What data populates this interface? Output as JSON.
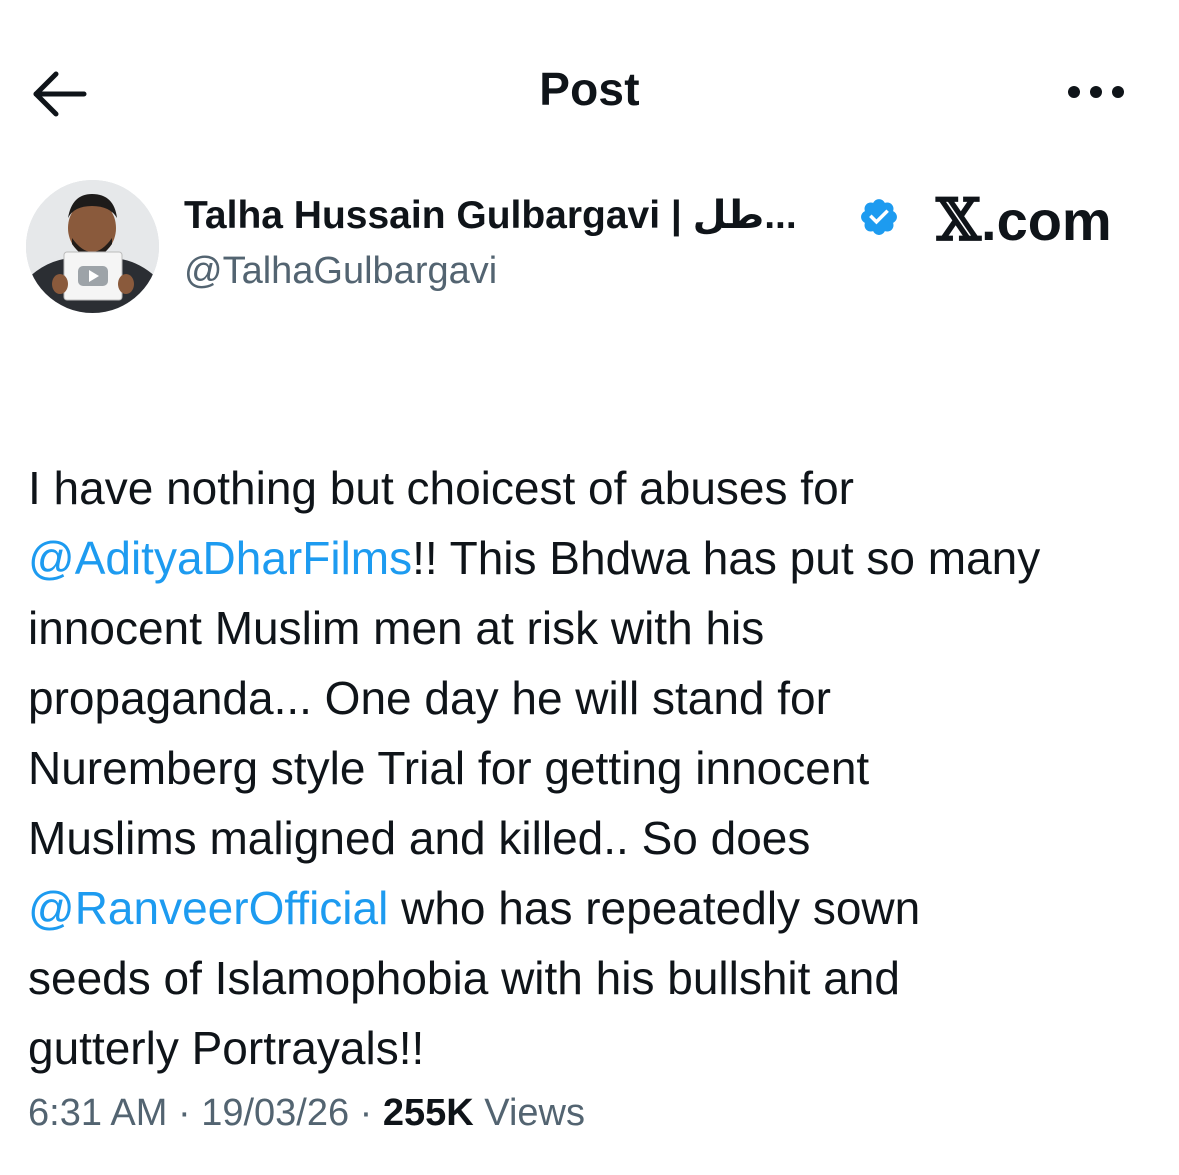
{
  "header": {
    "title": "Post",
    "back_icon": "arrow-left-icon",
    "more_icon": "more-horizontal-icon"
  },
  "author": {
    "display_name": "Talha Hussain Gulbargavi | طل...",
    "handle": "@TalhaGulbargavi",
    "verified": true,
    "verified_color": "#1d9bf0"
  },
  "watermark": {
    "text": ".com",
    "glyph": "𝕏"
  },
  "post": {
    "segments": [
      {
        "text": "I have nothing but choicest of abuses for\n",
        "mention": false
      },
      {
        "text": "@AdityaDharFilms",
        "mention": true
      },
      {
        "text": "!! This Bhdwa has put so many\ninnocent Muslim men at risk with his\npropaganda... One day he will stand for\nNuremberg style Trial for getting innocent\nMuslims maligned and killed.. So does\n",
        "mention": false
      },
      {
        "text": "@RanveerOfficial",
        "mention": true
      },
      {
        "text": " who has repeatedly sown\nseeds of Islamophobia with his bullshit and\ngutterly Portrayals!!",
        "mention": false
      }
    ]
  },
  "meta": {
    "time": "6:31 AM",
    "separator": " · ",
    "date": "19/03/26",
    "views_count": "255K",
    "views_label": " Views"
  },
  "colors": {
    "text": "#0f1419",
    "secondary": "#536471",
    "link": "#1d9bf0",
    "background": "#ffffff"
  }
}
